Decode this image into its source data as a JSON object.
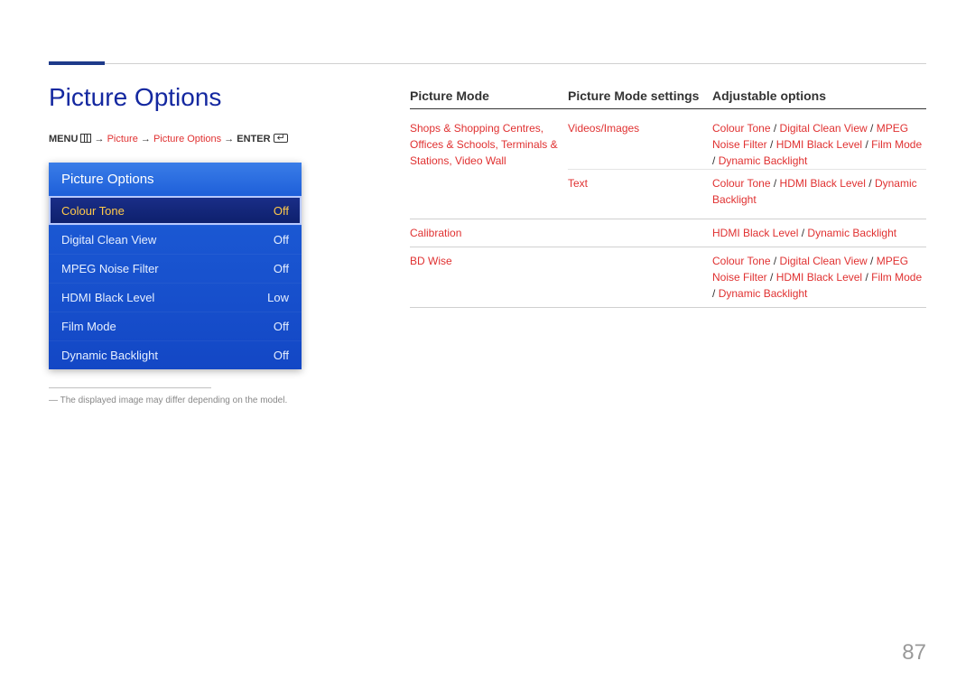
{
  "header": {
    "title": "Picture Options",
    "page_number": "87"
  },
  "breadcrumb": {
    "menu_label": "MENU",
    "sep": " → ",
    "picture": "Picture",
    "picture_options": "Picture Options",
    "enter_label": "ENTER"
  },
  "osd": {
    "title": "Picture Options",
    "items": [
      {
        "label": "Colour Tone",
        "value": "Off",
        "selected": true
      },
      {
        "label": "Digital Clean View",
        "value": "Off",
        "selected": false
      },
      {
        "label": "MPEG Noise Filter",
        "value": "Off",
        "selected": false
      },
      {
        "label": "HDMI Black Level",
        "value": "Low",
        "selected": false
      },
      {
        "label": "Film Mode",
        "value": "Off",
        "selected": false
      },
      {
        "label": "Dynamic Backlight",
        "value": "Off",
        "selected": false
      }
    ]
  },
  "footnote": "― The displayed image may differ depending on the model.",
  "table": {
    "headers": [
      "Picture Mode",
      "Picture Mode settings",
      "Adjustable options"
    ],
    "rows": [
      {
        "mode": "Shops & Shopping Centres, Offices & Schools, Terminals & Stations, Video Wall",
        "sub": [
          {
            "settings": "Videos/Images",
            "options": [
              "Colour Tone",
              "Digital Clean View",
              "MPEG Noise Filter",
              "HDMI Black Level",
              "Film Mode",
              "Dynamic Backlight"
            ]
          },
          {
            "settings": "Text",
            "options": [
              "Colour Tone",
              "HDMI Black Level",
              "Dynamic Backlight"
            ]
          }
        ]
      },
      {
        "mode": "Calibration",
        "sub": [
          {
            "settings": "",
            "options": [
              "HDMI Black Level",
              "Dynamic Backlight"
            ]
          }
        ]
      },
      {
        "mode": "BD Wise",
        "sub": [
          {
            "settings": "",
            "options": [
              "Colour Tone",
              "Digital Clean View",
              "MPEG Noise Filter",
              "HDMI Black Level",
              "Film Mode",
              "Dynamic Backlight"
            ]
          }
        ]
      }
    ]
  }
}
